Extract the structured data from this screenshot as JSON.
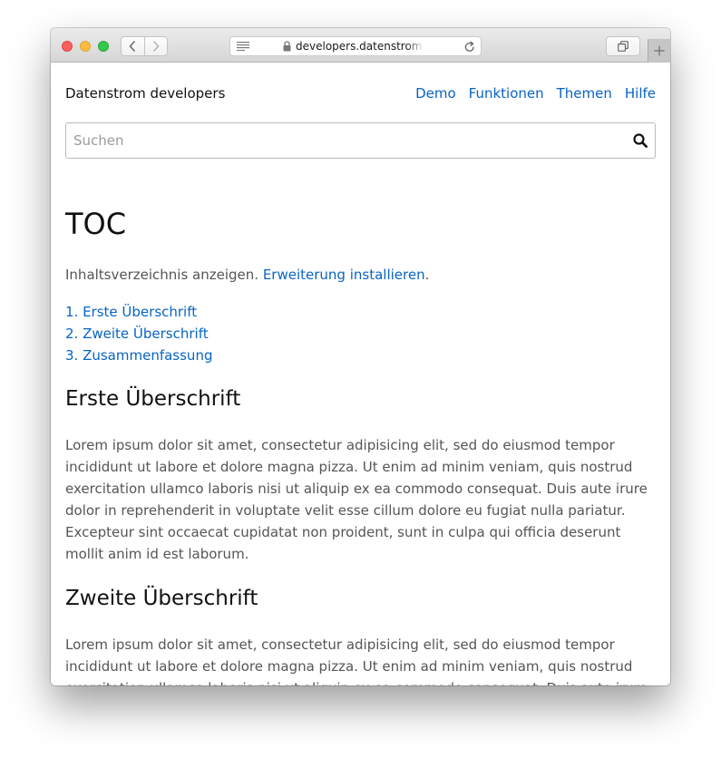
{
  "browser": {
    "url": "developers.datenstrom.se",
    "icons": {
      "back": "chevron-left-icon",
      "forward": "chevron-right-icon",
      "reader": "reader-view-icon",
      "lock": "lock-icon",
      "reload": "reload-icon",
      "tabs": "tab-overview-icon",
      "new_tab": "plus-icon"
    }
  },
  "site": {
    "title": "Datenstrom developers",
    "menu": [
      {
        "label": "Demo"
      },
      {
        "label": "Funktionen"
      },
      {
        "label": "Themen"
      },
      {
        "label": "Hilfe"
      }
    ],
    "search": {
      "placeholder": "Suchen",
      "value": ""
    },
    "link_color": "#0764c4"
  },
  "page": {
    "title": "TOC",
    "intro_text": "Inhaltsverzeichnis anzeigen.",
    "intro_link": "Erweiterung installieren",
    "intro_end": ".",
    "toc": [
      {
        "label": "1. Erste Überschrift"
      },
      {
        "label": "2. Zweite Überschrift"
      },
      {
        "label": "3. Zusammenfassung"
      }
    ],
    "sections": [
      {
        "heading": "Erste Überschrift",
        "text": "Lorem ipsum dolor sit amet, consectetur adipisicing elit, sed do eiusmod tempor incididunt ut labore et dolore magna pizza. Ut enim ad minim veniam, quis nostrud exercitation ullamco laboris nisi ut aliquip ex ea commodo consequat. Duis aute irure dolor in reprehenderit in voluptate velit esse cillum dolore eu fugiat nulla pariatur. Excepteur sint occaecat cupidatat non proident, sunt in culpa qui officia deserunt mollit anim id est laborum."
      },
      {
        "heading": "Zweite Überschrift",
        "text": "Lorem ipsum dolor sit amet, consectetur adipisicing elit, sed do eiusmod tempor incididunt ut labore et dolore magna pizza. Ut enim ad minim veniam, quis nostrud exercitation ullamco laboris nisi ut aliquip ex ea commodo consequat. Duis aute irure dolor in reprehenderit in voluptate velit esse cillum dolore eu fugiat nulla pariatur."
      }
    ]
  }
}
